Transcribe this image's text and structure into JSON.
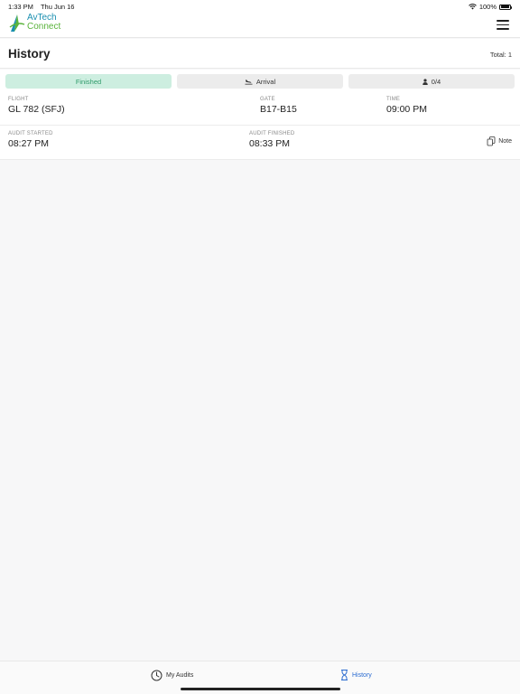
{
  "status_bar": {
    "time": "1:33 PM",
    "date": "Thu Jun 16",
    "battery": "100%"
  },
  "brand": {
    "line1": "AvTech",
    "line2": "Connect"
  },
  "header": {
    "title": "History",
    "total": "Total: 1"
  },
  "audit": {
    "status": "Finished",
    "direction": "Arrival",
    "crew": "0/4",
    "flight": {
      "label": "FLIGHT",
      "value": "GL 782 (SFJ)"
    },
    "gate": {
      "label": "GATE",
      "value": "B17-B15"
    },
    "time": {
      "label": "TIME",
      "value": "09:00 PM"
    },
    "audit_started": {
      "label": "AUDIT STARTED",
      "value": "08:27 PM"
    },
    "audit_finished": {
      "label": "AUDIT FINISHED",
      "value": "08:33 PM"
    },
    "note_label": "Note"
  },
  "tabs": [
    {
      "label": "My Audits",
      "icon": "clock-icon"
    },
    {
      "label": "History",
      "icon": "hourglass-icon",
      "active": true
    }
  ],
  "colors": {
    "finished_bg": "#cdeee0",
    "finished_text": "#2e9a6a",
    "active_tab": "#2a6bd0",
    "logo_blue": "#1a8fb0",
    "logo_green": "#5ab33b"
  }
}
